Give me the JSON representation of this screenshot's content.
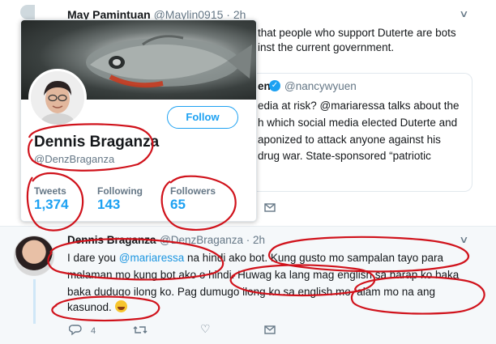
{
  "tweet1": {
    "name": "May Pamintuan",
    "handle": "@Maylin0915",
    "time": "· 2h",
    "text_lines": [
      "that people who support Duterte are bots",
      "inst the current government."
    ]
  },
  "quoted": {
    "name_fragment": "en",
    "handle": "@nancywyuen",
    "text_lines": [
      "edia at risk? @mariaressa talks about the",
      "h which social media elected Duterte and",
      "aponized to attack anyone against his",
      "drug war. State-sponsored “patriotic"
    ]
  },
  "hover_card": {
    "name": "Dennis Braganza",
    "handle": "@DenzBraganza",
    "follow_label": "Follow",
    "stats": [
      {
        "label": "Tweets",
        "value": "1,374"
      },
      {
        "label": "Following",
        "value": "143"
      },
      {
        "label": "Followers",
        "value": "65"
      }
    ]
  },
  "reply": {
    "name": "Dennis Braganza",
    "handle": "@DenzBraganza · 2h",
    "line1_pre": "I dare you ",
    "line1_mention": "@mariaressa",
    "line1_post": " na hindi ako bot. Kung gusto mo sampalan tayo para",
    "line2": "malaman mo kung bot ako o hindi. Huwag ka lang mag english sa harap ko baka",
    "line3": "baka dudugo ilong ko. Pag dumugo ilong ko sa english mo, alam mo na ang",
    "line4": "kasunod. ",
    "reply_count": "4"
  },
  "colors": {
    "accent": "#1da1f2",
    "annotation_red": "#d0121b",
    "text": "#14171a",
    "muted": "#657786"
  }
}
